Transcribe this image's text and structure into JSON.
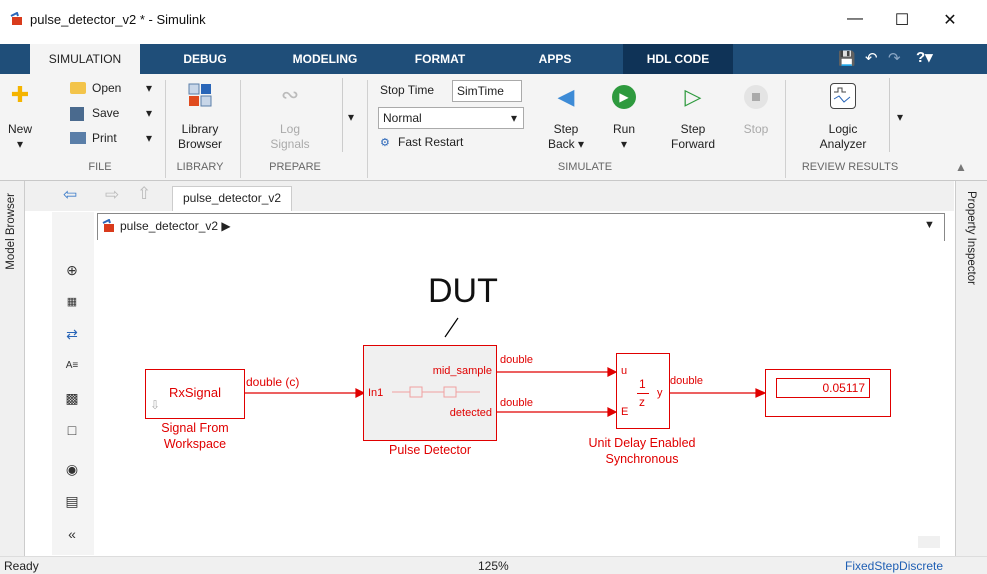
{
  "window": {
    "title": "pulse_detector_v2 * - Simulink",
    "controls": [
      "—",
      "☐",
      "✕"
    ]
  },
  "tabs": [
    "SIMULATION",
    "DEBUG",
    "MODELING",
    "FORMAT",
    "APPS",
    "HDL CODE"
  ],
  "ribbon": {
    "file": {
      "new_label": "New",
      "open_label": "Open",
      "save_label": "Save",
      "print_label": "Print",
      "section": "FILE"
    },
    "library": {
      "browser_label1": "Library",
      "browser_label2": "Browser",
      "section": "LIBRARY"
    },
    "prepare": {
      "log_label1": "Log",
      "log_label2": "Signals",
      "section": "PREPARE"
    },
    "simulate": {
      "stop_time_label": "Stop Time",
      "stop_time_value": "SimTime",
      "mode_value": "Normal",
      "fast_restart_label": "Fast Restart",
      "step_back1": "Step",
      "step_back2": "Back",
      "run_label": "Run",
      "step_fwd1": "Step",
      "step_fwd2": "Forward",
      "stop_label": "Stop",
      "section": "SIMULATE"
    },
    "review": {
      "logic1": "Logic",
      "logic2": "Analyzer",
      "section": "REVIEW RESULTS"
    }
  },
  "sidebar": {
    "model_browser": "Model Browser",
    "property_inspector": "Property Inspector"
  },
  "nav": {
    "tab_label": "pulse_detector_v2",
    "breadcrumb": "pulse_detector_v2"
  },
  "diagram": {
    "annotation": "DUT",
    "signal_block_text": "RxSignal",
    "signal_block_name1": "Signal From",
    "signal_block_name2": "Workspace",
    "signal_line_label": "double (c)",
    "pulse_in_port": "In1",
    "pulse_out_port1": "mid_sample",
    "pulse_out_port2": "detected",
    "pulse_block_name": "Pulse Detector",
    "line_label_top": "double",
    "line_label_bottom": "double",
    "delay_port_u": "u",
    "delay_port_e": "E",
    "delay_port_y": "y",
    "delay_num": "1",
    "delay_den": "z",
    "delay_name1": "Unit Delay Enabled",
    "delay_name2": "Synchronous",
    "out_line_label": "double",
    "display_value": "0.05117"
  },
  "status": {
    "left": "Ready",
    "zoom": "125%",
    "solver": "FixedStepDiscrete"
  },
  "colors": {
    "tab_bar": "#1f4e79",
    "hdl_tab": "#0f3357",
    "signal": "#e00000"
  }
}
